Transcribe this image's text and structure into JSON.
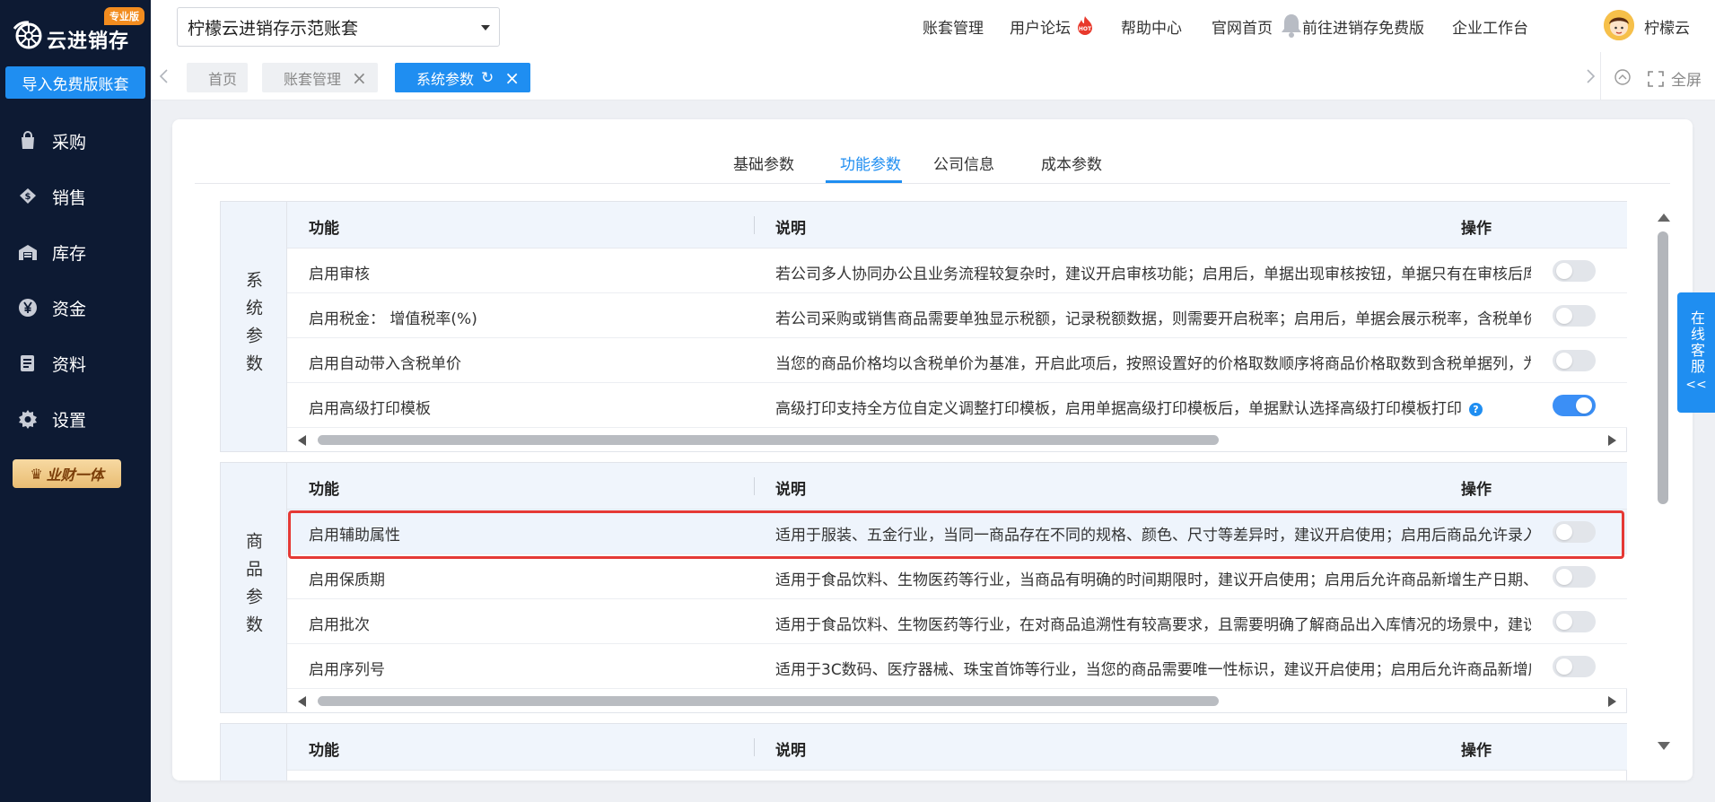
{
  "app": {
    "logo_text": "云进销存",
    "pro_badge": "专业版",
    "import_button": "导入免费版账套",
    "brand_badge": "业财一体"
  },
  "sidebar": {
    "items": [
      {
        "label": "采购",
        "icon": "bag-icon"
      },
      {
        "label": "销售",
        "icon": "sales-icon"
      },
      {
        "label": "库存",
        "icon": "warehouse-icon"
      },
      {
        "label": "资金",
        "icon": "yen-icon"
      },
      {
        "label": "资料",
        "icon": "document-icon"
      },
      {
        "label": "设置",
        "icon": "gear-icon"
      }
    ]
  },
  "header": {
    "account_select": "柠檬云进销存示范账套",
    "links": [
      "账套管理",
      "用户论坛",
      "帮助中心",
      "官网首页",
      "前往进销存免费版",
      "企业工作台"
    ],
    "hot_badge": "HOT",
    "user_name": "柠檬云"
  },
  "tabs": {
    "items": [
      {
        "label": "首页",
        "closable": false,
        "active": false
      },
      {
        "label": "账套管理",
        "closable": true,
        "active": false
      },
      {
        "label": "系统参数",
        "closable": true,
        "active": true
      }
    ],
    "fullscreen_label": "全屏"
  },
  "settings": {
    "sub_tabs": [
      "基础参数",
      "功能参数",
      "公司信息",
      "成本参数"
    ],
    "active_sub_tab": "功能参数",
    "columns": {
      "func": "功能",
      "desc": "说明",
      "op": "操作"
    },
    "sections": [
      {
        "label": "系统参数",
        "rows": [
          {
            "func": "启用审核",
            "desc": "若公司多人协同办公且业务流程较复杂时，建议开启审核功能；启用后，单据出现审核按钮，单据只有在审核后库",
            "enabled": false
          },
          {
            "func": "启用税金： 增值税率(%)",
            "desc": "若公司采购或销售商品需要单独显示税额，记录税额数据，则需要开启税率；启用后，单据会展示税率，含税单价",
            "enabled": false
          },
          {
            "func": "启用自动带入含税单价",
            "desc": "当您的商品价格均以含税单价为基准，开启此项后，按照设置好的价格取数顺序将商品价格取数到含税单据列，为",
            "enabled": false
          },
          {
            "func": "启用高级打印模板",
            "desc": "高级打印支持全方位自定义调整打印模板，启用单据高级打印模板后，单据默认选择高级打印模板打印",
            "enabled": true,
            "help": "?"
          }
        ]
      },
      {
        "label": "商品参数",
        "rows": [
          {
            "func": "启用辅助属性",
            "desc": "适用于服装、五金行业，当同一商品存在不同的规格、颜色、尺寸等差异时，建议开启使用；启用后商品允许录入",
            "enabled": false
          },
          {
            "func": "启用保质期",
            "desc": "适用于食品饮料、生物医药等行业，当商品有明确的时间期限时，建议开启使用；启用后允许商品新增生产日期、",
            "enabled": false
          },
          {
            "func": "启用批次",
            "desc": "适用于食品饮料、生物医药等行业，在对商品追溯性有较高要求，且需要明确了解商品出入库情况的场景中，建议",
            "enabled": false
          },
          {
            "func": "启用序列号",
            "desc": "适用于3C数码、医疗器械、珠宝首饰等行业，当您的商品需要唯一性标识，建议开启使用；启用后允许商品新增序",
            "enabled": false
          }
        ]
      }
    ]
  },
  "service": {
    "label": "在线客服",
    "arrow": "<<"
  },
  "colors": {
    "sidebar_bg": "#0d1a33",
    "accent": "#1f8ef1",
    "highlight": "#e53935"
  }
}
